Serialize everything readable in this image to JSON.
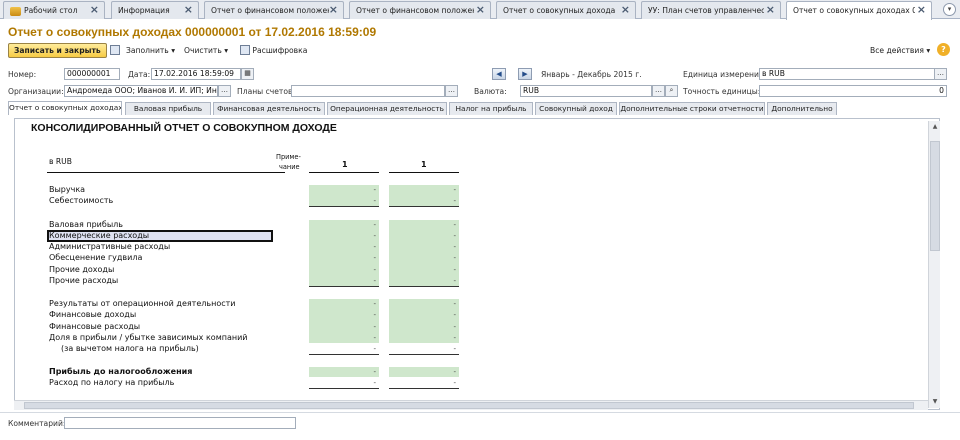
{
  "tabs": [
    {
      "label": "Рабочий стол",
      "icon": "home-icon"
    },
    {
      "label": "Информация"
    },
    {
      "label": "Отчет о финансовом положении"
    },
    {
      "label": "Отчет о финансовом положени..."
    },
    {
      "label": "Отчет о совокупных доходах"
    },
    {
      "label": "УУ: План счетов управленчес..."
    },
    {
      "label": "Отчет о совокупных доходах 0..."
    }
  ],
  "close_glyph": "×",
  "title": "Отчет о совокупных доходах 000000001 от 17.02.2016 18:59:09",
  "toolbar": {
    "save": "Записать и закрыть",
    "fill": "Заполнить ▾",
    "clear": "Очистить ▾",
    "decode": "Расшифровка",
    "all_actions": "Все действия ▾",
    "help": "?"
  },
  "form": {
    "number_label": "Номер:",
    "number": "000000001",
    "date_label": "Дата:",
    "date": "17.02.2016 18:59:09",
    "period": "Январь - Декабрь 2015 г.",
    "unit_label": "Единица измерения:",
    "unit": "в RUB",
    "org_label": "Организации:",
    "org": "Андромеда ООО; Иванов И. И. ИП; Интер ···",
    "plans_label": "Планы счетов:",
    "plans": "",
    "currency_label": "Валюта:",
    "currency": "RUB",
    "precision_label": "Точность единицы:",
    "precision": "0"
  },
  "form_tabs": [
    "Отчет о совокупных доходах",
    "Валовая прибыль",
    "Финансовая деятельность",
    "Операционная деятельность",
    "Налог на прибыль",
    "Совокупный доход",
    "Дополнительные строки отчетности",
    "Дополнительно"
  ],
  "report": {
    "heading": "КОНСОЛИДИРОВАННЫЙ ОТЧЕТ О СОВОКУПНОМ ДОХОДЕ",
    "unit": "в RUB",
    "note_header_1": "Приме-",
    "note_header_2": "чание",
    "col_headers": [
      "1",
      "1"
    ],
    "dash": "-",
    "rows": [
      {
        "label": "Выручка",
        "bold": false
      },
      {
        "label": "Себестоимость",
        "bold": false
      },
      {
        "label": "Валовая прибыль",
        "bold": false
      },
      {
        "label": "Коммерческие расходы",
        "bold": false,
        "selected": true
      },
      {
        "label": "Административные расходы",
        "bold": false
      },
      {
        "label": "Обесценение гудвила",
        "bold": false
      },
      {
        "label": "Прочие доходы",
        "bold": false
      },
      {
        "label": "Прочие расходы",
        "bold": false
      },
      {
        "label": "Результаты от операционной деятельности",
        "bold": false
      },
      {
        "label": "Финансовые доходы",
        "bold": false
      },
      {
        "label": "Финансовые расходы",
        "bold": false
      },
      {
        "label": "Доля в прибыли / убытке зависимых компаний",
        "bold": false
      },
      {
        "label": "(за вычетом налога на прибыль)",
        "bold": false
      },
      {
        "label": "Прибыль до налогообложения",
        "bold": true
      },
      {
        "label": "Расход по налогу на прибыль",
        "bold": false
      }
    ]
  },
  "comment_label": "Комментарий:",
  "comment": "",
  "scroll_up": "▲",
  "scroll_down": "▼"
}
